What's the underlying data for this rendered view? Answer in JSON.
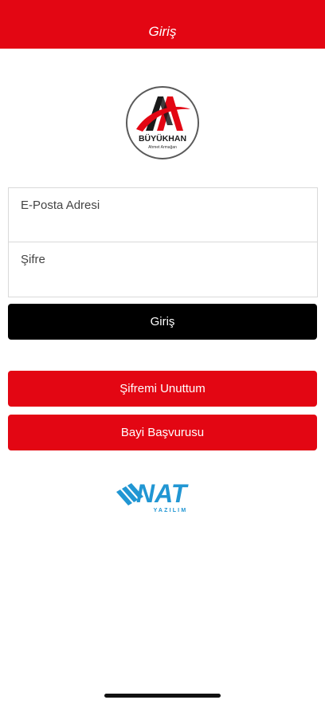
{
  "header": {
    "title": "Giriş"
  },
  "brand_logo": {
    "name": "BÜYÜKHAN",
    "subtitle": "Ahmet Armağan"
  },
  "login_form": {
    "email_placeholder": "E-Posta Adresi",
    "password_placeholder": "Şifre"
  },
  "buttons": {
    "login_label": "Giriş",
    "forgot_label": "Şifremi Unuttum",
    "dealer_label": "Bayi Başvurusu"
  },
  "footer_logo": {
    "name": "NAT",
    "subtitle": "YAZILIM"
  },
  "colors": {
    "brand_red": "#e30613",
    "login_button": "#000000",
    "nat_blue": "#2196d3"
  }
}
